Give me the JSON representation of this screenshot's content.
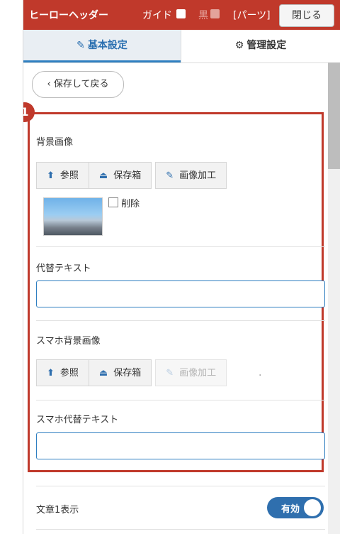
{
  "header": {
    "title": "ヒーローヘッダー",
    "guide_label": "ガイド",
    "black_label": "黒",
    "parts_label": "[パーツ]",
    "close_label": "閉じる"
  },
  "tabs": [
    {
      "label": "基本設定",
      "icon": "edit-icon",
      "active": true
    },
    {
      "label": "管理設定",
      "icon": "gear-icon",
      "active": false
    }
  ],
  "back_button": "保存して戻る",
  "badge": "1",
  "background_image": {
    "label": "背景画像",
    "buttons": [
      "参照",
      "保存箱",
      "画像加工"
    ],
    "delete_label": "削除"
  },
  "alt_text": {
    "label": "代替テキスト",
    "value": ""
  },
  "sp_background_image": {
    "label": "スマホ背景画像",
    "buttons": [
      "参照",
      "保存箱",
      "画像加工"
    ],
    "suffix": "."
  },
  "sp_alt_text": {
    "label": "スマホ代替テキスト",
    "value": ""
  },
  "text1_display": {
    "label": "文章1表示",
    "toggle_label": "有効",
    "enabled": true
  },
  "colors": {
    "header": "#c0392b",
    "accent": "#2f6fae",
    "highlight": "#c0392b"
  }
}
